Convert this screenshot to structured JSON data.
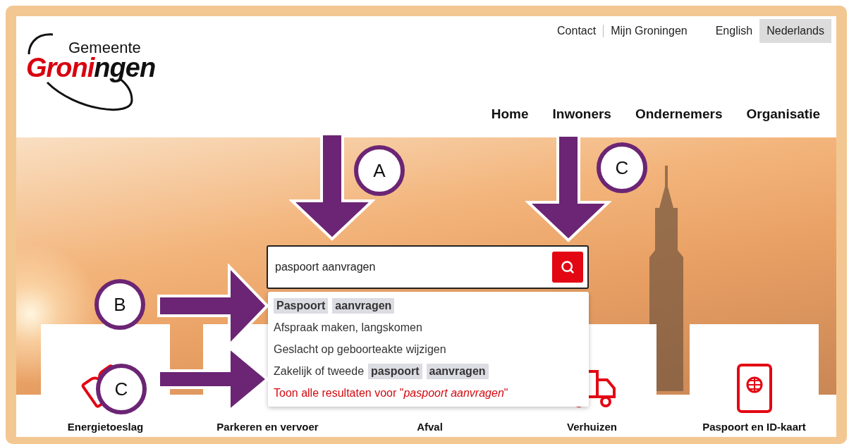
{
  "logo": {
    "top_line": "Gemeente",
    "red_part": "Groni",
    "black_part": "ngen"
  },
  "top_links": [
    "Contact",
    "Mijn Groningen"
  ],
  "languages": [
    {
      "label": "English",
      "selected": false
    },
    {
      "label": "Nederlands",
      "selected": true
    }
  ],
  "main_nav": [
    "Home",
    "Inwoners",
    "Ondernemers",
    "Organisatie"
  ],
  "search": {
    "value": "paspoort aanvragen"
  },
  "suggestions": [
    {
      "kind": "suggestion",
      "parts": [
        {
          "text": "Paspoort",
          "highlight": true
        },
        {
          "text": "aanvragen",
          "highlight": true
        }
      ]
    },
    {
      "kind": "suggestion",
      "parts": [
        {
          "text": "Afspraak maken, langskomen",
          "highlight": false
        }
      ]
    },
    {
      "kind": "suggestion",
      "parts": [
        {
          "text": "Geslacht op geboorteakte wijzigen",
          "highlight": false
        }
      ]
    },
    {
      "kind": "suggestion",
      "parts": [
        {
          "text": "Zakelijk of tweede",
          "highlight": false
        },
        {
          "text": "paspoort",
          "highlight": true
        },
        {
          "text": "aanvragen",
          "highlight": true
        }
      ]
    },
    {
      "kind": "show_all",
      "parts": [
        {
          "text": "Toon alle resultaten voor \"*paspoort aanvragen*\"",
          "highlight": false
        }
      ]
    }
  ],
  "cards": [
    "Energietoeslag",
    "Parkeren en vervoer",
    "Afval",
    "Verhuizen",
    "Paspoort en ID-kaart"
  ],
  "annotations": [
    {
      "label": "A",
      "kind": "down"
    },
    {
      "label": "C",
      "kind": "down"
    },
    {
      "label": "B",
      "kind": "right"
    },
    {
      "label": "C",
      "kind": "right"
    }
  ]
}
